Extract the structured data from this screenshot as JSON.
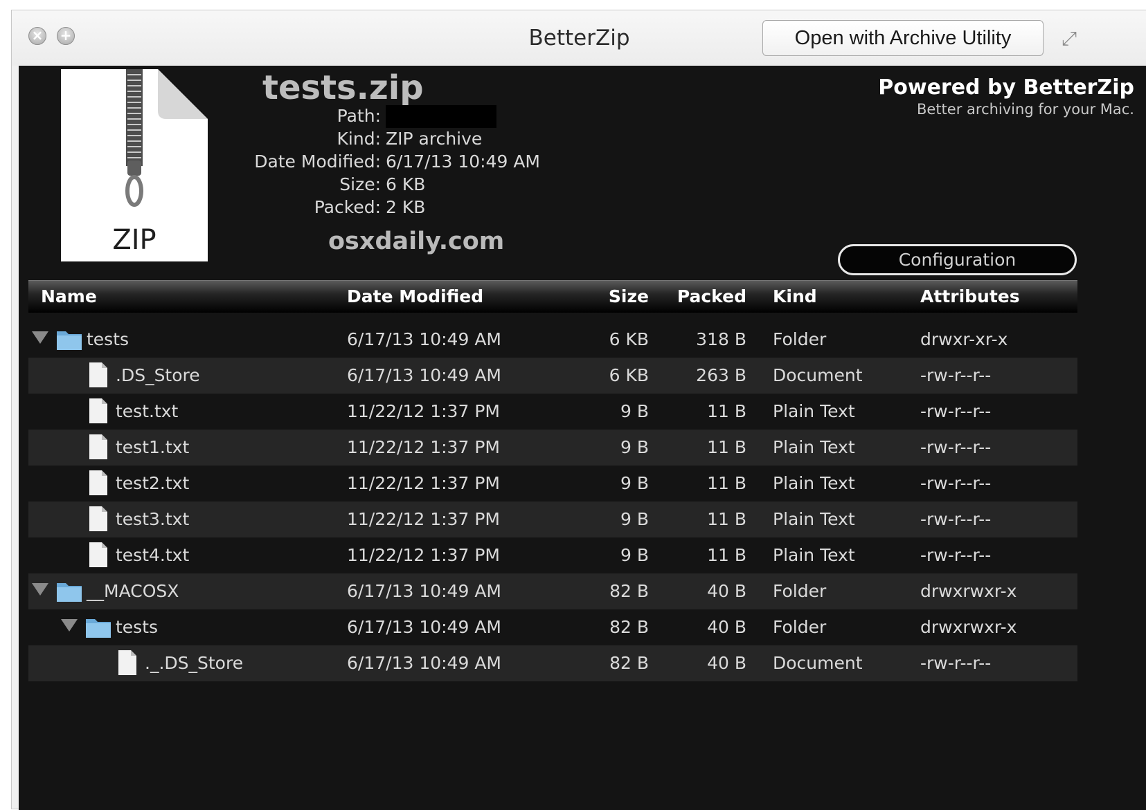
{
  "window": {
    "title": "BetterZip",
    "open_button_label": "Open with Archive Utility"
  },
  "archive": {
    "name": "tests.zip",
    "icon_label": "ZIP",
    "path_label": "Path:",
    "path_value": "",
    "kind_label": "Kind:",
    "kind_value": "ZIP archive",
    "date_label": "Date Modified:",
    "date_value": "6/17/13 10:49 AM",
    "size_label": "Size:",
    "size_value": "6 KB",
    "packed_label": "Packed:",
    "packed_value": "2 KB",
    "watermark": "osxdaily.com"
  },
  "branding": {
    "title": "Powered by BetterZip",
    "subtitle": "Better archiving for your Mac.",
    "config_button": "Configuration"
  },
  "table": {
    "columns": {
      "name": "Name",
      "date": "Date Modified",
      "size": "Size",
      "packed": "Packed",
      "kind": "Kind",
      "attributes": "Attributes"
    },
    "rows": [
      {
        "name": "tests",
        "type": "folder",
        "level": 0,
        "expanded": true,
        "date": "6/17/13 10:49 AM",
        "size": "6 KB",
        "packed": "318 B",
        "kind": "Folder",
        "attributes": "drwxr-xr-x"
      },
      {
        "name": ".DS_Store",
        "type": "document",
        "level": 1,
        "date": "6/17/13 10:49 AM",
        "size": "6 KB",
        "packed": "263 B",
        "kind": "Document",
        "attributes": "-rw-r--r--"
      },
      {
        "name": "test.txt",
        "type": "document",
        "level": 1,
        "date": "11/22/12 1:37 PM",
        "size": "9 B",
        "packed": "11 B",
        "kind": "Plain Text",
        "attributes": "-rw-r--r--"
      },
      {
        "name": "test1.txt",
        "type": "document",
        "level": 1,
        "date": "11/22/12 1:37 PM",
        "size": "9 B",
        "packed": "11 B",
        "kind": "Plain Text",
        "attributes": "-rw-r--r--"
      },
      {
        "name": "test2.txt",
        "type": "document",
        "level": 1,
        "date": "11/22/12 1:37 PM",
        "size": "9 B",
        "packed": "11 B",
        "kind": "Plain Text",
        "attributes": "-rw-r--r--"
      },
      {
        "name": "test3.txt",
        "type": "document",
        "level": 1,
        "date": "11/22/12 1:37 PM",
        "size": "9 B",
        "packed": "11 B",
        "kind": "Plain Text",
        "attributes": "-rw-r--r--"
      },
      {
        "name": "test4.txt",
        "type": "document",
        "level": 1,
        "date": "11/22/12 1:37 PM",
        "size": "9 B",
        "packed": "11 B",
        "kind": "Plain Text",
        "attributes": "-rw-r--r--"
      },
      {
        "name": "__MACOSX",
        "type": "folder",
        "level": 0,
        "expanded": true,
        "date": "6/17/13 10:49 AM",
        "size": "82 B",
        "packed": "40 B",
        "kind": "Folder",
        "attributes": "drwxrwxr-x"
      },
      {
        "name": "tests",
        "type": "folder",
        "level": 1,
        "expanded": true,
        "date": "6/17/13 10:49 AM",
        "size": "82 B",
        "packed": "40 B",
        "kind": "Folder",
        "attributes": "drwxrwxr-x"
      },
      {
        "name": "._.DS_Store",
        "type": "document",
        "level": 2,
        "date": "6/17/13 10:49 AM",
        "size": "82 B",
        "packed": "40 B",
        "kind": "Document",
        "attributes": "-rw-r--r--"
      }
    ]
  },
  "colors": {
    "panel_background": "#141414",
    "alternate_row": "#262626",
    "folder_blue": "#8fc6ec"
  }
}
